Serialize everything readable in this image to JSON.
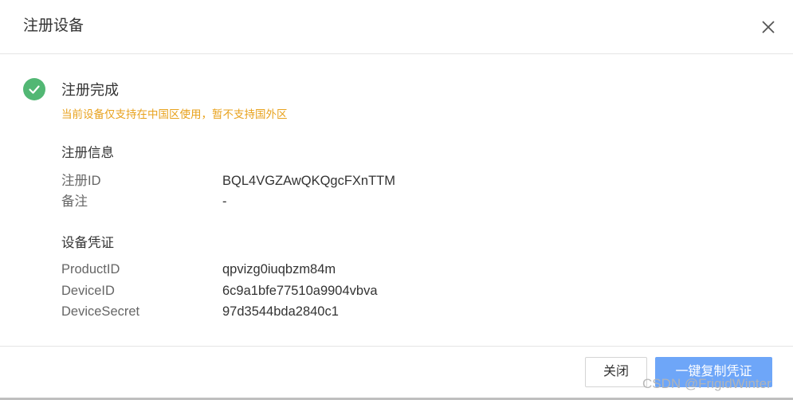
{
  "dialog": {
    "title": "注册设备",
    "close_icon": "close-icon",
    "status": {
      "icon": "check-circle-icon",
      "icon_color": "#52b774",
      "title": "注册完成",
      "warning": "当前设备仅支持在中国区使用，暂不支持国外区",
      "warning_color": "#e8a21d"
    },
    "registration_info": {
      "title": "注册信息",
      "rows": [
        {
          "label": "注册ID",
          "value": "BQL4VGZAwQKQgcFXnTTM"
        },
        {
          "label": "备注",
          "value": "-"
        }
      ]
    },
    "device_credentials": {
      "title": "设备凭证",
      "rows": [
        {
          "label": "ProductID",
          "value": "qpvizg0iuqbzm84m"
        },
        {
          "label": "DeviceID",
          "value": "6c9a1bfe77510a9904vbva"
        },
        {
          "label": "DeviceSecret",
          "value": "97d3544bda2840c1"
        }
      ]
    },
    "buttons": {
      "close_label": "关闭",
      "copy_label": "一键复制凭证",
      "primary_color": "#6ea6f8"
    }
  },
  "watermark": "CSDN @FrigidWinter"
}
